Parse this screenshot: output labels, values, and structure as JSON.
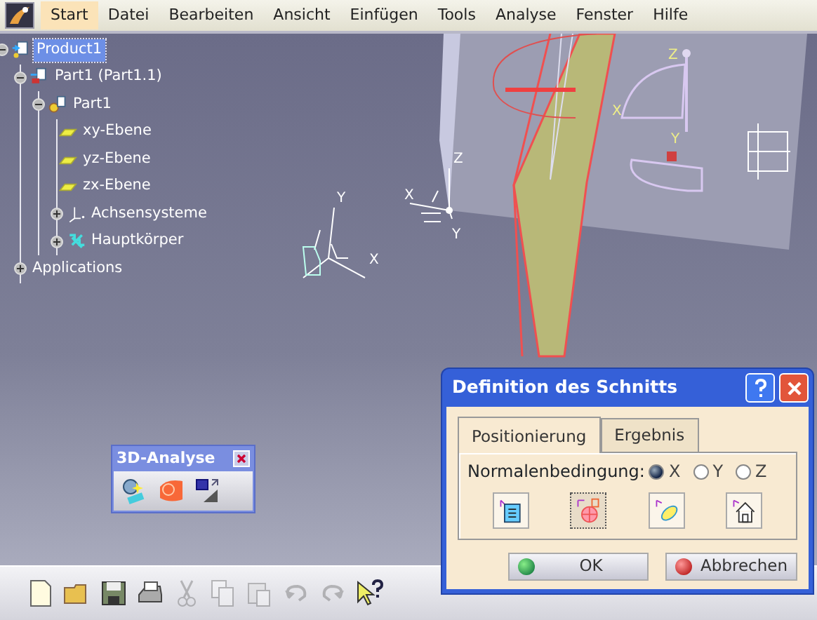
{
  "menu": {
    "items": [
      {
        "label": "Start",
        "selected": true
      },
      {
        "label": "Datei",
        "selected": false
      },
      {
        "label": "Bearbeiten",
        "selected": false
      },
      {
        "label": "Ansicht",
        "selected": false
      },
      {
        "label": "Einfügen",
        "selected": false
      },
      {
        "label": "Tools",
        "selected": false
      },
      {
        "label": "Analyse",
        "selected": false
      },
      {
        "label": "Fenster",
        "selected": false
      },
      {
        "label": "Hilfe",
        "selected": false
      }
    ]
  },
  "tree": [
    {
      "label": "Product1",
      "kind": "product",
      "selected": true,
      "expanded": true,
      "children": [
        {
          "label": "Part1 (Part1.1)",
          "kind": "part",
          "selected": false,
          "expanded": true,
          "children": [
            {
              "label": "Part1",
              "kind": "body",
              "selected": false,
              "expanded": true,
              "children": [
                {
                  "label": "xy-Ebene",
                  "kind": "plane",
                  "selected": false
                },
                {
                  "label": "yz-Ebene",
                  "kind": "plane",
                  "selected": false
                },
                {
                  "label": "zx-Ebene",
                  "kind": "plane",
                  "selected": false
                },
                {
                  "label": "Achsensysteme",
                  "kind": "axis",
                  "selected": false,
                  "expanded": false
                },
                {
                  "label": "Hauptkörper",
                  "kind": "geometry",
                  "selected": false,
                  "expanded": false
                }
              ]
            }
          ]
        },
        {
          "label": "Applications",
          "kind": "app",
          "selected": false,
          "expanded": false
        }
      ]
    }
  ],
  "scene": {
    "labels": [
      "Z",
      "X",
      "Y",
      "Z",
      "X",
      "Y",
      "Y",
      "X"
    ]
  },
  "analysis_toolbar": {
    "title": "3D-Analyse",
    "tools": [
      {
        "kind": "analysis"
      },
      {
        "kind": "draft"
      },
      {
        "kind": "compare"
      }
    ]
  },
  "dialog": {
    "title": "Definition des Schnitts",
    "tabs": [
      {
        "label": "Positionierung",
        "selected": true
      },
      {
        "label": "Ergebnis",
        "selected": false
      }
    ],
    "normal_label": "Normalenbedingung:",
    "radios": [
      {
        "label": "X",
        "selected": true
      },
      {
        "label": "Y",
        "selected": false
      },
      {
        "label": "Z",
        "selected": false
      }
    ],
    "tools": [
      {
        "kind": "edit",
        "selected": false
      },
      {
        "kind": "position",
        "selected": true
      },
      {
        "kind": "rotate",
        "selected": false
      },
      {
        "kind": "home",
        "selected": false
      }
    ],
    "buttons": [
      {
        "label": "OK",
        "kind": "ok"
      },
      {
        "label": "Abbrechen",
        "kind": "cancel"
      }
    ]
  },
  "toolbar": {
    "tools": [
      {
        "kind": "new",
        "disabled": false
      },
      {
        "kind": "open",
        "disabled": false
      },
      {
        "kind": "save",
        "disabled": false
      },
      {
        "kind": "print",
        "disabled": false
      },
      {
        "kind": "cut",
        "disabled": true
      },
      {
        "kind": "copy",
        "disabled": true
      },
      {
        "kind": "paste",
        "disabled": true
      },
      {
        "kind": "undo",
        "disabled": true
      },
      {
        "kind": "redo",
        "disabled": true
      },
      {
        "kind": "help",
        "disabled": false
      }
    ]
  }
}
